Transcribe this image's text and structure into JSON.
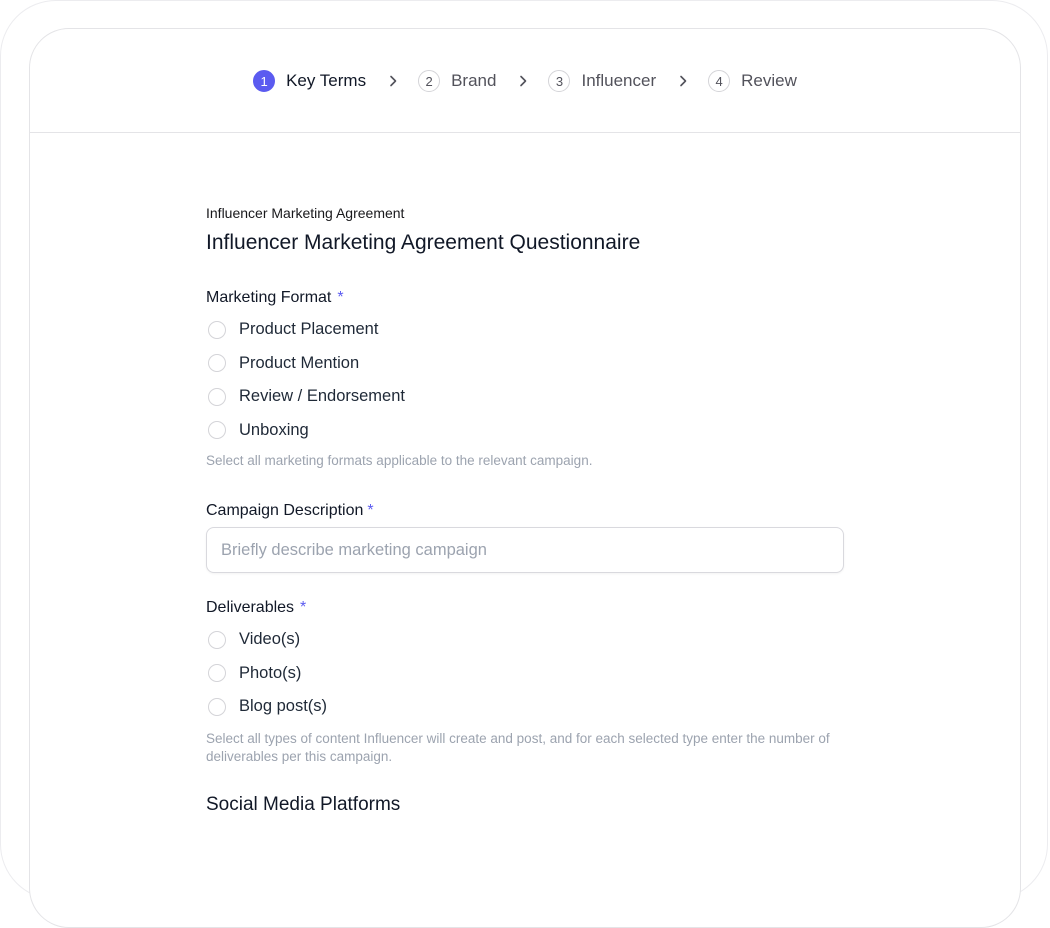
{
  "stepper": {
    "steps": [
      {
        "num": "1",
        "label": "Key Terms"
      },
      {
        "num": "2",
        "label": "Brand"
      },
      {
        "num": "3",
        "label": "Influencer"
      },
      {
        "num": "4",
        "label": "Review"
      }
    ],
    "active_step": "1"
  },
  "form": {
    "eyebrow": "Influencer Marketing Agreement",
    "title": "Influencer Marketing Agreement Questionnaire",
    "marketing_format": {
      "label": "Marketing Format",
      "required_mark": "*",
      "options": [
        "Product Placement",
        "Product Mention",
        "Review / Endorsement",
        "Unboxing"
      ],
      "help": "Select all marketing formats applicable to the relevant campaign."
    },
    "campaign_description": {
      "label": "Campaign Description",
      "required_mark": "*",
      "placeholder": "Briefly describe marketing campaign",
      "value": ""
    },
    "deliverables": {
      "label": "Deliverables",
      "required_mark": "*",
      "options": [
        "Video(s)",
        "Photo(s)",
        "Blog post(s)"
      ],
      "help": "Select all types of content Influencer will create and post, and for each selected type enter the number of deliverables per this campaign."
    },
    "social_media": {
      "heading": "Social Media Platforms"
    }
  },
  "colors": {
    "accent": "#5b5bf0",
    "border": "#e4e4e7",
    "muted_text": "#9ca3af"
  }
}
